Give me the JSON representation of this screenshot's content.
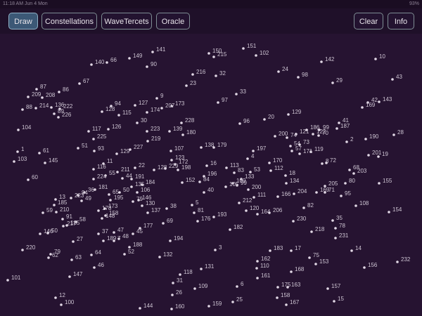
{
  "status_bar": {
    "time": "11:18 AM",
    "date": "Jun 4 Mon",
    "battery": "93%"
  },
  "toolbar": {
    "left_buttons": [
      {
        "label": "Draw",
        "active": true
      },
      {
        "label": "Constellations",
        "active": false
      },
      {
        "label": "WaveTercets",
        "active": false
      },
      {
        "label": "Oracle",
        "active": false
      }
    ],
    "right_buttons": [
      {
        "label": "Clear"
      },
      {
        "label": "Info"
      }
    ]
  },
  "stars": [
    [
      151,
      352,
      66
    ],
    [
      150,
      303,
      73
    ],
    [
      215,
      310,
      78
    ],
    [
      102,
      370,
      76
    ],
    [
      141,
      223,
      71
    ],
    [
      149,
      190,
      80
    ],
    [
      66,
      158,
      86
    ],
    [
      140,
      136,
      89
    ],
    [
      90,
      215,
      92
    ],
    [
      10,
      540,
      81
    ],
    [
      142,
      463,
      85
    ],
    [
      216,
      280,
      103
    ],
    [
      32,
      313,
      105
    ],
    [
      24,
      402,
      99
    ],
    [
      98,
      430,
      107
    ],
    [
      43,
      564,
      110
    ],
    [
      29,
      479,
      115
    ],
    [
      23,
      271,
      119
    ],
    [
      67,
      119,
      116
    ],
    [
      87,
      58,
      124
    ],
    [
      86,
      90,
      128
    ],
    [
      209,
      46,
      135
    ],
    [
      208,
      66,
      136
    ],
    [
      33,
      342,
      131
    ],
    [
      9,
      229,
      137
    ],
    [
      97,
      316,
      143
    ],
    [
      127,
      198,
      147
    ],
    [
      94,
      164,
      148
    ],
    [
      173,
      250,
      148
    ],
    [
      207,
      236,
      151
    ],
    [
      174,
      215,
      157
    ],
    [
      128,
      151,
      156
    ],
    [
      115,
      175,
      161
    ],
    [
      88,
      38,
      153
    ],
    [
      214,
      57,
      151
    ],
    [
      136,
      79,
      150
    ],
    [
      222,
      91,
      152
    ],
    [
      89,
      83,
      159
    ],
    [
      226,
      89,
      164
    ],
    [
      42,
      529,
      143
    ],
    [
      143,
      545,
      142
    ],
    [
      169,
      521,
      150
    ],
    [
      129,
      416,
      160
    ],
    [
      20,
      382,
      167
    ],
    [
      96,
      347,
      173
    ],
    [
      200,
      397,
      191
    ],
    [
      74,
      414,
      193
    ],
    [
      121,
      427,
      188
    ],
    [
      186,
      442,
      182
    ],
    [
      99,
      460,
      182
    ],
    [
      41,
      488,
      172
    ],
    [
      187,
      485,
      180
    ],
    [
      122,
      451,
      188
    ],
    [
      70,
      459,
      190
    ],
    [
      30,
      201,
      172
    ],
    [
      228,
      264,
      172
    ],
    [
      223,
      215,
      184
    ],
    [
      139,
      247,
      184
    ],
    [
      180,
      266,
      189
    ],
    [
      117,
      132,
      184
    ],
    [
      126,
      160,
      181
    ],
    [
      104,
      32,
      182
    ],
    [
      225,
      139,
      195
    ],
    [
      219,
      216,
      198
    ],
    [
      28,
      566,
      189
    ],
    [
      2,
      499,
      199
    ],
    [
      190,
      526,
      195
    ],
    [
      54,
      419,
      205
    ],
    [
      73,
      432,
      203
    ],
    [
      57,
      421,
      212
    ],
    [
      119,
      448,
      213
    ],
    [
      171,
      432,
      216
    ],
    [
      8,
      464,
      230
    ],
    [
      72,
      470,
      229
    ],
    [
      201,
      530,
      218
    ],
    [
      19,
      544,
      220
    ],
    [
      51,
      117,
      208
    ],
    [
      93,
      140,
      212
    ],
    [
      227,
      191,
      210
    ],
    [
      129,
      172,
      216
    ],
    [
      138,
      292,
      207
    ],
    [
      179,
      310,
      207
    ],
    [
      107,
      249,
      212
    ],
    [
      197,
      366,
      212
    ],
    [
      1,
      31,
      213
    ],
    [
      61,
      62,
      215
    ],
    [
      103,
      26,
      227
    ],
    [
      145,
      70,
      229
    ],
    [
      4,
      358,
      223
    ],
    [
      170,
      389,
      229
    ],
    [
      123,
      250,
      225
    ],
    [
      11,
      153,
      230
    ],
    [
      172,
      255,
      231
    ],
    [
      22,
      198,
      236
    ],
    [
      128,
      225,
      239
    ],
    [
      229,
      241,
      237
    ],
    [
      198,
      259,
      239
    ],
    [
      116,
      139,
      238
    ],
    [
      211,
      173,
      242
    ],
    [
      16,
      300,
      233
    ],
    [
      113,
      328,
      236
    ],
    [
      83,
      339,
      243
    ],
    [
      53,
      362,
      242
    ],
    [
      112,
      391,
      240
    ],
    [
      196,
      296,
      248
    ],
    [
      55,
      156,
      247
    ],
    [
      44,
      180,
      251
    ],
    [
      191,
      193,
      252
    ],
    [
      224,
      139,
      252
    ],
    [
      18,
      412,
      247
    ],
    [
      133,
      349,
      252
    ],
    [
      80,
      497,
      258
    ],
    [
      68,
      503,
      239
    ],
    [
      203,
      509,
      244
    ],
    [
      152,
      265,
      257
    ],
    [
      84,
      290,
      256
    ],
    [
      109,
      337,
      258
    ],
    [
      99,
      343,
      261
    ],
    [
      105,
      327,
      263
    ],
    [
      134,
      413,
      258
    ],
    [
      155,
      545,
      258
    ],
    [
      60,
      46,
      253
    ],
    [
      135,
      193,
      263
    ],
    [
      184,
      208,
      260
    ],
    [
      181,
      141,
      267
    ],
    [
      106,
      201,
      271
    ],
    [
      36,
      126,
      271
    ],
    [
      223,
      107,
      279
    ],
    [
      94,
      117,
      275
    ],
    [
      65,
      161,
      274
    ],
    [
      50,
      176,
      271
    ],
    [
      200,
      359,
      267
    ],
    [
      40,
      296,
      271
    ],
    [
      111,
      367,
      278
    ],
    [
      166,
      401,
      277
    ],
    [
      204,
      424,
      273
    ],
    [
      169,
      456,
      271
    ],
    [
      71,
      468,
      271
    ],
    [
      205,
      468,
      262
    ],
    [
      95,
      491,
      276
    ],
    [
      13,
      85,
      281
    ],
    [
      49,
      122,
      283
    ],
    [
      195,
      163,
      282
    ],
    [
      146,
      203,
      282
    ],
    [
      79,
      195,
      284
    ],
    [
      212,
      346,
      286
    ],
    [
      82,
      438,
      293
    ],
    [
      108,
      512,
      290
    ],
    [
      154,
      559,
      299
    ],
    [
      185,
      83,
      289
    ],
    [
      5,
      279,
      289
    ],
    [
      38,
      243,
      294
    ],
    [
      130,
      208,
      290
    ],
    [
      120,
      356,
      297
    ],
    [
      164,
      372,
      302
    ],
    [
      206,
      389,
      300
    ],
    [
      210,
      86,
      299
    ],
    [
      59,
      67,
      300
    ],
    [
      178,
      146,
      297
    ],
    [
      173,
      155,
      294
    ],
    [
      158,
      156,
      304
    ],
    [
      137,
      216,
      300
    ],
    [
      81,
      282,
      300
    ],
    [
      193,
      310,
      306
    ],
    [
      91,
      95,
      309
    ],
    [
      58,
      114,
      313
    ],
    [
      148,
      151,
      308
    ],
    [
      176,
      287,
      312
    ],
    [
      35,
      479,
      311
    ],
    [
      230,
      423,
      312
    ],
    [
      69,
      238,
      315
    ],
    [
      217,
      96,
      319
    ],
    [
      185,
      101,
      318
    ],
    [
      78,
      483,
      322
    ],
    [
      182,
      333,
      324
    ],
    [
      177,
      205,
      322
    ],
    [
      218,
      449,
      327
    ],
    [
      45,
      195,
      330
    ],
    [
      47,
      168,
      328
    ],
    [
      37,
      146,
      330
    ],
    [
      50,
      74,
      329
    ],
    [
      146,
      63,
      330
    ],
    [
      231,
      483,
      336
    ],
    [
      27,
      110,
      341
    ],
    [
      189,
      153,
      340
    ],
    [
      48,
      175,
      337
    ],
    [
      7,
      168,
      340
    ],
    [
      194,
      248,
      340
    ],
    [
      188,
      190,
      349
    ],
    [
      3,
      312,
      353
    ],
    [
      183,
      390,
      354
    ],
    [
      17,
      420,
      354
    ],
    [
      14,
      506,
      354
    ],
    [
      220,
      38,
      353
    ],
    [
      79,
      78,
      359
    ],
    [
      62,
      75,
      364
    ],
    [
      64,
      136,
      360
    ],
    [
      52,
      183,
      359
    ],
    [
      63,
      108,
      367
    ],
    [
      132,
      233,
      363
    ],
    [
      75,
      446,
      364
    ],
    [
      162,
      372,
      369
    ],
    [
      153,
      455,
      373
    ],
    [
      232,
      571,
      370
    ],
    [
      156,
      524,
      378
    ],
    [
      46,
      140,
      378
    ],
    [
      110,
      371,
      379
    ],
    [
      131,
      292,
      380
    ],
    [
      118,
      262,
      388
    ],
    [
      168,
      420,
      384
    ],
    [
      147,
      105,
      391
    ],
    [
      161,
      372,
      393
    ],
    [
      101,
      17,
      396
    ],
    [
      31,
      252,
      400
    ],
    [
      6,
      343,
      405
    ],
    [
      109,
      283,
      408
    ],
    [
      175,
      401,
      406
    ],
    [
      163,
      415,
      406
    ],
    [
      157,
      472,
      408
    ],
    [
      26,
      251,
      417
    ],
    [
      12,
      85,
      421
    ],
    [
      158,
      400,
      421
    ],
    [
      167,
      413,
      431
    ],
    [
      15,
      481,
      426
    ],
    [
      25,
      337,
      427
    ],
    [
      100,
      93,
      431
    ],
    [
      144,
      205,
      436
    ],
    [
      160,
      250,
      437
    ],
    [
      159,
      303,
      433
    ]
  ]
}
